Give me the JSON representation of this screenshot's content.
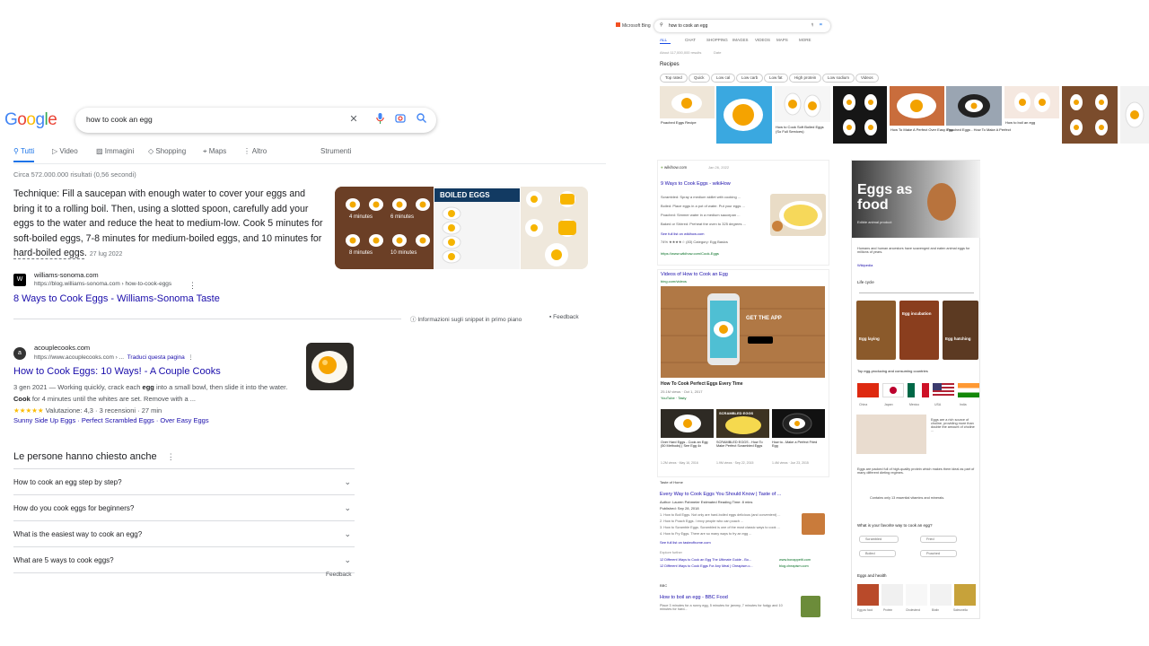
{
  "google": {
    "logo": "Google",
    "query": "how to cook an egg",
    "tabs": [
      "Tutti",
      "Video",
      "Immagini",
      "Shopping",
      "Maps",
      "Altro",
      "Strumenti"
    ],
    "stats": "Circa 572.000.000 risultati (0,56 secondi)",
    "snippet": {
      "pre": "Technique: Fill a saucepan with enough water to cover your eggs and bring it to a rolling boil. Then, using a slotted spoon, carefully add your eggs to the water and reduce the heat to medium-low. Cook 5 minutes for soft-boiled eggs, 7-8 minutes for medium-boiled eggs, and 10 minutes for ",
      "hard": "hard-boiled eggs",
      "post": ".",
      "date": "27 lug 2022"
    },
    "img_labels": {
      "m4": "4 minutes",
      "m6": "6 minutes",
      "m8": "8 minutes",
      "m10": "10 minutes",
      "boiled": "BOILED EGGS"
    },
    "result1": {
      "site": "williams-sonoma.com",
      "url": "https://blog.williams-sonoma.com › how-to-cook-eggs",
      "title": "8 Ways to Cook Eggs - Williams-Sonoma Taste"
    },
    "about_snippets": "Informazioni sugli snippet in primo piano",
    "feedback": "Feedback",
    "result2": {
      "site": "acouplecooks.com",
      "url": "https://www.acouplecooks.com › ...",
      "translate": "Traduci questa pagina",
      "title": "How to Cook Eggs: 10 Ways! - A Couple Cooks",
      "desc_pre": "3 gen 2021 — Working quickly, crack each ",
      "egg1": "egg",
      "desc_mid": " into a small bowl, then slide it into the water. ",
      "cook": "Cook",
      "desc_post": " for 4 minutes until the whites are set. Remove with a ...",
      "stars": "★★★★★",
      "rating": "Valutazione: 4,3 · 3 recensioni · 27 min",
      "sublinks": "Sunny Side Up Eggs · Perfect Scrambled Eggs · Over Easy Eggs"
    },
    "paa_title": "Le persone hanno chiesto anche",
    "paa": [
      "How to cook an egg step by step?",
      "How do you cook eggs for beginners?",
      "What is the easiest way to cook an egg?",
      "What are 5 ways to cook eggs?"
    ],
    "feedback2": "Feedback"
  },
  "bing": {
    "brand": "Microsoft Bing",
    "query": "how to cook an egg",
    "tabs": [
      "ALL",
      "CHAT",
      "SHOPPING",
      "IMAGES",
      "VIDEOS",
      "MAPS",
      "MORE"
    ],
    "about": "About 117,000,000 results",
    "date": "Date",
    "recipes": "Recipes",
    "chips": [
      "Top rated",
      "Quick",
      "Low cal",
      "Low carb",
      "Low fat",
      "High protein",
      "Low sodium",
      "Videos"
    ],
    "tile_captions": [
      "Poached Eggs Recipe",
      "",
      "How to Cook Soft Boiled Eggs (So Full Services)",
      "",
      "How To Make A Perfect Over Easy Egg",
      "Poached Eggs - How To Make A Perfect",
      "How to boil an egg"
    ],
    "wikihow": {
      "site": "wikihow.com",
      "date": "Jan 26, 2022",
      "title": "9 Ways to Cook Eggs - wikiHow",
      "bullets": [
        "Scrambled: Spray a medium skillet with cooking ...",
        "Boiled: Place eggs in a pot of water. Put your eggs ...",
        "Poached: Simmer water in a medium saucepan ...",
        "Baked or Shirred: Preheat the oven to 325 degrees ..."
      ],
      "more": "See full list on wikihow.com",
      "rating": "74% ★★★★☆ (83)   Category: Egg Basics",
      "url": "https://www.wikihow.com/Cook-Eggs"
    },
    "videos": {
      "title": "Videos of How to Cook an Egg",
      "source": "bing.com/videos",
      "app": "GET THE APP",
      "vtitle": "How To Cook Perfect Eggs Every Time",
      "meta": "25.1M views · Oct 1, 2017",
      "channel": "YouTube · Tasty"
    },
    "video_thumbs": [
      {
        "title": "Over Hard Eggs - Cook an Egg (50 Methods) | See Egg 4x",
        "meta": "1.2M views · May 16, 2016"
      },
      {
        "title": "SCRAMBLED EGGS - How To Make Perfect Scrambled Eggs",
        "meta": "1.9M views · Sep 22, 2015"
      },
      {
        "title": "How to...Make a Perfect Fried Egg",
        "meta": "1.4M views · Jun 23, 2015"
      }
    ],
    "thumb_label": "SCRAMBLED EGGS",
    "toh": {
      "site": "Taste of Home",
      "title": "Every Way to Cook Eggs You Should Know | Taste of ...",
      "author": "Author: Lauren Pahmeier   Estimated Reading Time: 8 mins",
      "published": "Published: Sep 28, 2018",
      "items": [
        "1. How to Boil Eggs. Not only are hard-boiled eggs delicious (and convenient) ...",
        "2. How to Poach Eggs. I envy people who can poach ...",
        "3. How to Scramble Eggs. Scrambled is one of the most classic ways to cook ...",
        "4. How to Fry Eggs. There are so many ways to fry an egg ..."
      ],
      "more": "See full list on tasteofhome.com",
      "explore": "Explore further",
      "rel1": "12 Different Ways to Cook an Egg The Ultimate Guide - Bo...",
      "rel1s": "www.bonappetit.com",
      "rel2": "12 Different Ways to Cook Eggs For Any Meal | Cheapism.c...",
      "rel2s": "blog.cheapism.com"
    },
    "bbc": {
      "site": "BBC",
      "title": "How to boil an egg - BBC Food",
      "desc": "Place 3 minutes for a runny egg, 5 minutes for jammy, 7 minutes for fudgy and 10 minutes for hard..."
    },
    "side": {
      "hero": "Eggs as food",
      "hero_sub": "Edible animal product",
      "desc": "Humans and human ancestors have scavenged and eaten animal eggs for millions of years.",
      "wiki": "Wikipedia",
      "life": "Life cycle",
      "cycle": [
        "Egg laying",
        "Egg incubation",
        "Egg hatching"
      ],
      "prod": "Top egg-producing and consuming countries",
      "countries": [
        "China",
        "Japan",
        "Mexico",
        "USA",
        "India"
      ],
      "facts1": "Eggs are a rich source of choline, providing more than double the amount of choline ...",
      "facts2": "Eggs are packed full of high-quality protein which makes them ideal as part of many different dieting regimes.",
      "facts3": "Contains only 13 essential vitamins and minerals.",
      "fav": "What is your favorite way to cook an egg?",
      "opts": [
        "Scrambled",
        "Fried",
        "Boiled",
        "Poached"
      ],
      "health": "Eggs and health",
      "health_items": [
        "Egg as food",
        "Protein",
        "Cholesterol",
        "Biotin",
        "Salmonella"
      ]
    }
  }
}
